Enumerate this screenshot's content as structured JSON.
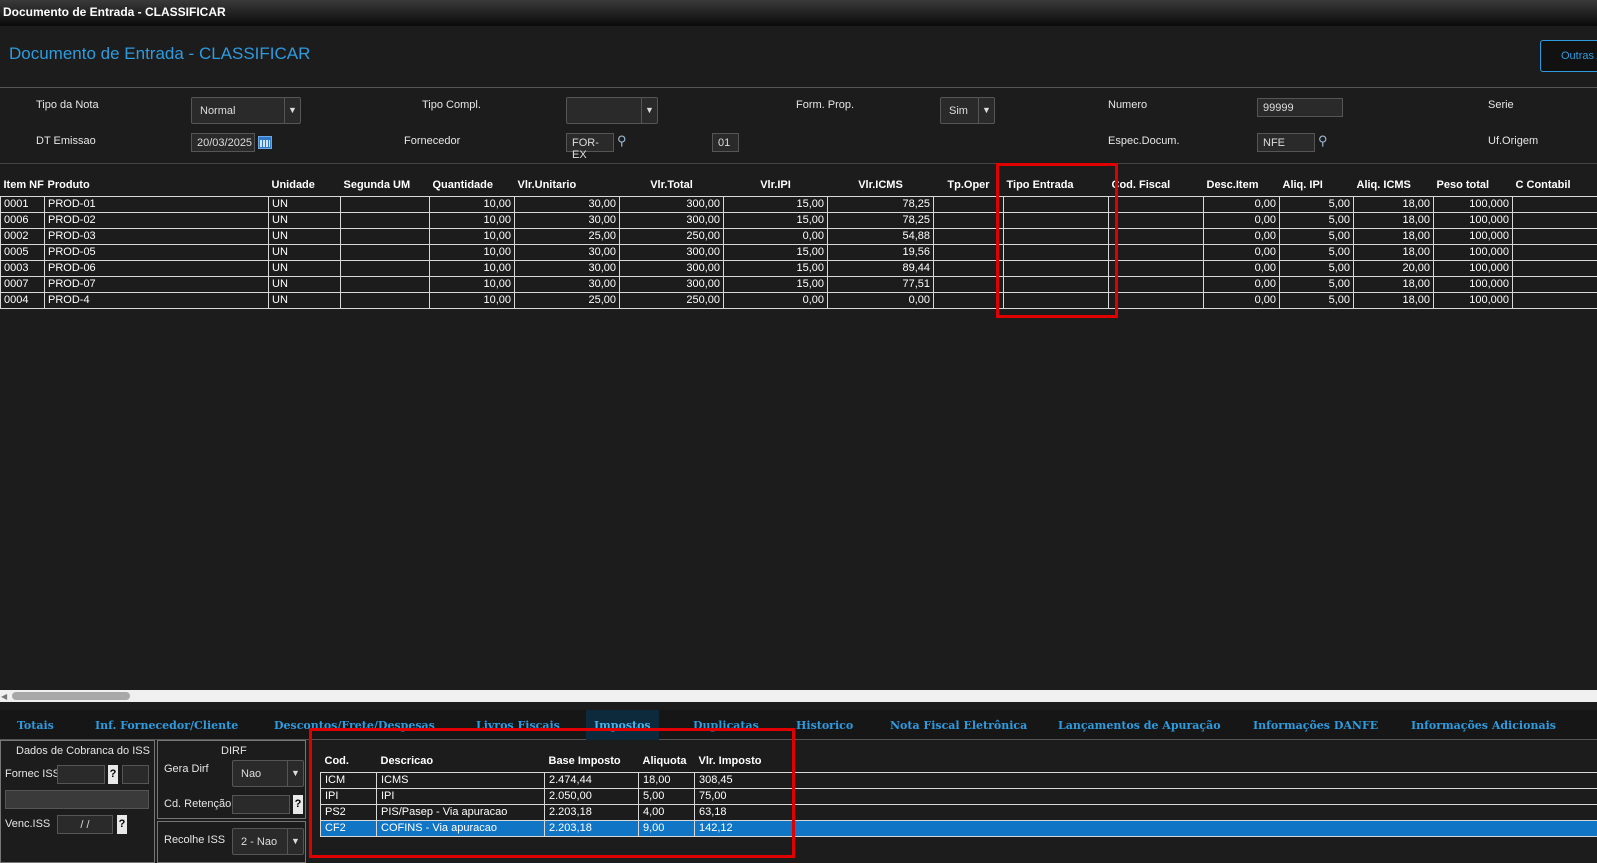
{
  "window": {
    "title": "Documento de Entrada - CLASSIFICAR"
  },
  "header": {
    "page_title": "Documento de Entrada - CLASSIFICAR",
    "outras_label": "Outras A"
  },
  "form": {
    "tipo_nota_label": "Tipo da Nota",
    "tipo_nota_value": "Normal",
    "tipo_compl_label": "Tipo Compl.",
    "tipo_compl_value": "",
    "form_prop_label": "Form. Prop.",
    "form_prop_value": "Sim",
    "numero_label": "Numero",
    "numero_value": "99999",
    "serie_label": "Serie",
    "dt_emissao_label": "DT Emissao",
    "dt_emissao_value": "20/03/2025",
    "fornecedor_label": "Fornecedor",
    "fornecedor_value": "FOR-EX",
    "loja_value": "01",
    "espec_label": "Espec.Docum.",
    "espec_value": "NFE",
    "uf_origem_label": "Uf.Origem"
  },
  "items_grid": {
    "columns": [
      "Item NF",
      "Produto",
      "Unidade",
      "Segunda UM",
      "Quantidade",
      "Vlr.Unitario",
      "Vlr.Total",
      "Vlr.IPI",
      "Vlr.ICMS",
      "Tp.Oper",
      "Tipo Entrada",
      "Cod. Fiscal",
      "Desc.Item",
      "Aliq. IPI",
      "Aliq. ICMS",
      "Peso total",
      "C Contabil"
    ],
    "rows": [
      [
        "0001",
        "PROD-01",
        "UN",
        "",
        "10,00",
        "30,00",
        "300,00",
        "15,00",
        "78,25",
        "",
        "",
        "",
        "0,00",
        "5,00",
        "18,00",
        "100,000",
        ""
      ],
      [
        "0006",
        "PROD-02",
        "UN",
        "",
        "10,00",
        "30,00",
        "300,00",
        "15,00",
        "78,25",
        "",
        "",
        "",
        "0,00",
        "5,00",
        "18,00",
        "100,000",
        ""
      ],
      [
        "0002",
        "PROD-03",
        "UN",
        "",
        "10,00",
        "25,00",
        "250,00",
        "0,00",
        "54,88",
        "",
        "",
        "",
        "0,00",
        "5,00",
        "18,00",
        "100,000",
        ""
      ],
      [
        "0005",
        "PROD-05",
        "UN",
        "",
        "10,00",
        "30,00",
        "300,00",
        "15,00",
        "19,56",
        "",
        "",
        "",
        "0,00",
        "5,00",
        "18,00",
        "100,000",
        ""
      ],
      [
        "0003",
        "PROD-06",
        "UN",
        "",
        "10,00",
        "30,00",
        "300,00",
        "15,00",
        "89,44",
        "",
        "",
        "",
        "0,00",
        "5,00",
        "20,00",
        "100,000",
        ""
      ],
      [
        "0007",
        "PROD-07",
        "UN",
        "",
        "10,00",
        "30,00",
        "300,00",
        "15,00",
        "77,51",
        "",
        "",
        "",
        "0,00",
        "5,00",
        "18,00",
        "100,000",
        ""
      ],
      [
        "0004",
        "PROD-4",
        "UN",
        "",
        "10,00",
        "25,00",
        "250,00",
        "0,00",
        "0,00",
        "",
        "",
        "",
        "0,00",
        "5,00",
        "18,00",
        "100,000",
        ""
      ]
    ]
  },
  "tabs": [
    "Totais",
    "Inf. Fornecedor/Cliente",
    "Descontos/Frete/Despesas",
    "Livros Fiscais",
    "Impostos",
    "Duplicatas",
    "Historico",
    "Nota Fiscal Eletrônica",
    "Lançamentos de Apuração",
    "Informações DANFE",
    "Informações Adicionais"
  ],
  "iss_panel": {
    "title": "Dados de Cobranca do ISS",
    "fornec_label": "Fornec ISS",
    "venc_label": "Venc.ISS",
    "venc_value": " / /",
    "help": "?"
  },
  "dirf_panel": {
    "title": "DIRF",
    "gera_label": "Gera Dirf",
    "gera_value": "Nao",
    "retencao_label": "Cd. Retenção",
    "help": "?"
  },
  "recolhe_panel": {
    "label": "Recolhe ISS",
    "value": "2 - Nao"
  },
  "tax_grid": {
    "columns": [
      "Cod.",
      "Descricao",
      "Base Imposto",
      "Aliquota",
      "Vlr. Imposto"
    ],
    "rows": [
      [
        "ICM",
        "ICMS",
        "2.474,44",
        "18,00",
        "308,45"
      ],
      [
        "IPI",
        "IPI",
        "2.050,00",
        "5,00",
        "75,00"
      ],
      [
        "PS2",
        "PIS/Pasep - Via apuracao",
        "2.203,18",
        "4,00",
        "63,18"
      ],
      [
        "CF2",
        "COFINS - Via apuracao",
        "2.203,18",
        "9,00",
        "142,12"
      ]
    ],
    "selected_row": 3
  },
  "colors": {
    "accent": "#2e9bdf",
    "highlight_box": "#e00000",
    "selected_row": "#1075c4"
  }
}
